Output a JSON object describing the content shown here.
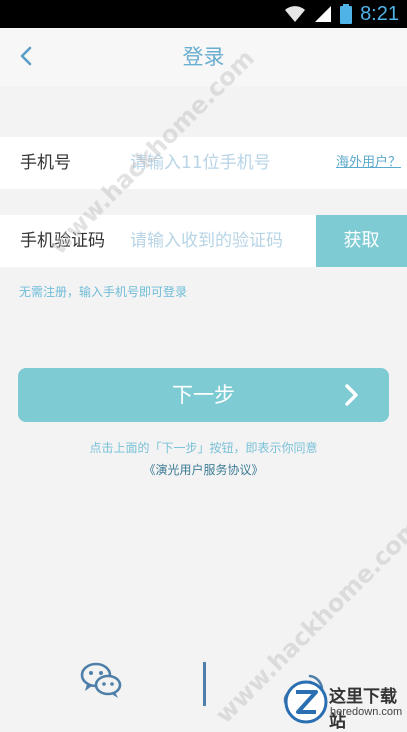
{
  "status": {
    "time": "8:21",
    "icons": [
      "wifi-icon",
      "signal-icon",
      "battery-icon"
    ]
  },
  "header": {
    "title": "登录",
    "back_icon": "chevron-left-icon"
  },
  "phone_row": {
    "label": "手机号",
    "placeholder": "请输入11位手机号",
    "overseas_link": "海外用户？"
  },
  "code_row": {
    "label": "手机验证码",
    "placeholder": "请输入收到的验证码",
    "get_code_label": "获取"
  },
  "hint": "无需注册，输入手机号即可登录",
  "next_button": {
    "label": "下一步",
    "icon": "chevron-right-icon"
  },
  "agreement": {
    "text": "点击上面的「下一步」按钮，即表示你同意",
    "link": "《演光用户服务协议》"
  },
  "social": {
    "wechat_icon": "wechat-icon",
    "weibo_icon": "weibo-icon"
  },
  "watermark": {
    "site": "www.hackhome.com",
    "logo_name": "这里下载站",
    "logo_sub": "heredown.com"
  },
  "colors": {
    "accent": "#7fcbd3",
    "title": "#6aaed0",
    "link": "#5aa8cc",
    "background": "#f3f3f3"
  }
}
